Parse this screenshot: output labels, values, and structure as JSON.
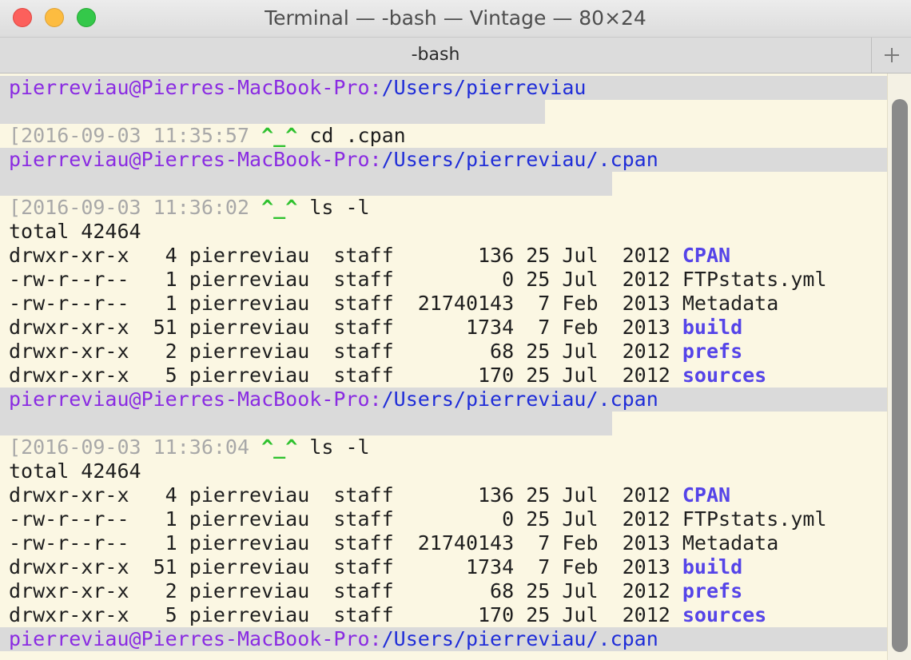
{
  "window": {
    "title": "Terminal — -bash — Vintage — 80×24"
  },
  "tabs": [
    {
      "label": "-bash"
    }
  ],
  "new_tab": {
    "label": "+"
  },
  "prompt": {
    "user": "pierreviau@Pierres-MacBook-Pro:",
    "path_home": "/Users/pierreviau",
    "path_cpan": "/Users/pierreviau/.cpan",
    "smile": "^_^"
  },
  "commands": [
    {
      "bracket": "[",
      "timestamp": "2016-09-03 11:35:57",
      "cmd": "cd .cpan"
    },
    {
      "bracket": "[",
      "timestamp": "2016-09-03 11:36:02",
      "cmd": "ls -l"
    },
    {
      "bracket": "[",
      "timestamp": "2016-09-03 11:36:04",
      "cmd": "ls -l"
    }
  ],
  "listing": {
    "total": "total 42464",
    "entries": [
      {
        "meta": "drwxr-xr-x   4 pierreviau  staff       136 25 Jul  2012 ",
        "name": "CPAN",
        "dir": true
      },
      {
        "meta": "-rw-r--r--   1 pierreviau  staff         0 25 Jul  2012 ",
        "name": "FTPstats.yml",
        "dir": false
      },
      {
        "meta": "-rw-r--r--   1 pierreviau  staff  21740143  7 Feb  2013 ",
        "name": "Metadata",
        "dir": false
      },
      {
        "meta": "drwxr-xr-x  51 pierreviau  staff      1734  7 Feb  2013 ",
        "name": "build",
        "dir": true
      },
      {
        "meta": "drwxr-xr-x   2 pierreviau  staff        68 25 Jul  2012 ",
        "name": "prefs",
        "dir": true
      },
      {
        "meta": "drwxr-xr-x   5 pierreviau  staff       170 25 Jul  2012 ",
        "name": "sources",
        "dir": true
      }
    ]
  },
  "colors": {
    "background": "#fbf7e3",
    "prompt_user": "#8a2be2",
    "prompt_path": "#1f2dd8",
    "timestamp": "#a8a8a8",
    "smile": "#2ec12e",
    "directory": "#5544e8"
  }
}
